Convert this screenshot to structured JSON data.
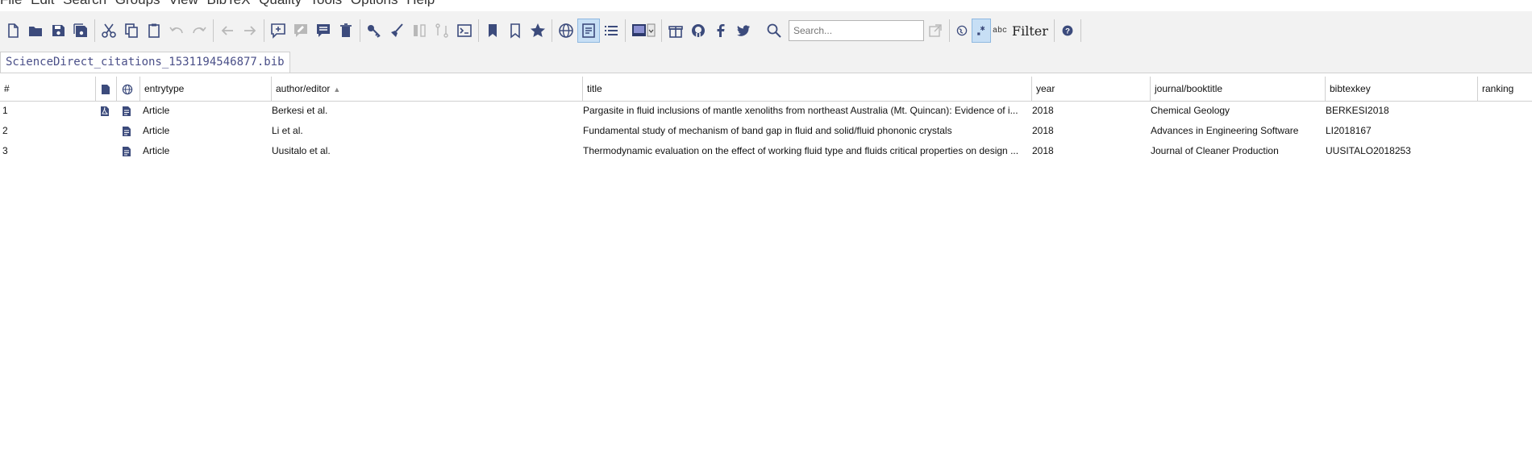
{
  "menu": {
    "items": [
      "File",
      "Edit",
      "Search",
      "Groups",
      "View",
      "BibTeX",
      "Quality",
      "Tools",
      "Options",
      "Help"
    ]
  },
  "toolbar": {
    "search_placeholder": "Search...",
    "filter_label": "Filter",
    "abc_label": "abc"
  },
  "tabs": [
    {
      "label": "ScienceDirect_citations_1531194546877.bib"
    }
  ],
  "table": {
    "columns": {
      "num": "#",
      "entrytype": "entrytype",
      "author": "author/editor",
      "title": "title",
      "year": "year",
      "journal": "journal/booktitle",
      "bibtexkey": "bibtexkey",
      "ranking": "ranking"
    },
    "sort_column": "author/editor",
    "rows": [
      {
        "num": "1",
        "entrytype": "Article",
        "author": "Berkesi et al.",
        "title": "Pargasite in fluid inclusions of mantle xenoliths from northeast Australia (Mt. Quincan): Evidence of i...",
        "year": "2018",
        "journal": "Chemical Geology",
        "bibtexkey": "BERKESI2018"
      },
      {
        "num": "2",
        "entrytype": "Article",
        "author": "Li et al.",
        "title": "Fundamental study of mechanism of band gap in fluid and solid/fluid phononic crystals",
        "year": "2018",
        "journal": "Advances in Engineering Software",
        "bibtexkey": "LI2018167"
      },
      {
        "num": "3",
        "entrytype": "Article",
        "author": "Uusitalo et al.",
        "title": "Thermodynamic evaluation on the effect of working fluid type and fluids critical properties on design ...",
        "year": "2018",
        "journal": "Journal of Cleaner Production",
        "bibtexkey": "UUSITALO2018253"
      }
    ]
  },
  "colors": {
    "icon": "#3c4b7c",
    "icon_disabled": "#b8b8b8",
    "pdf_icon": "#3c4b7c"
  }
}
